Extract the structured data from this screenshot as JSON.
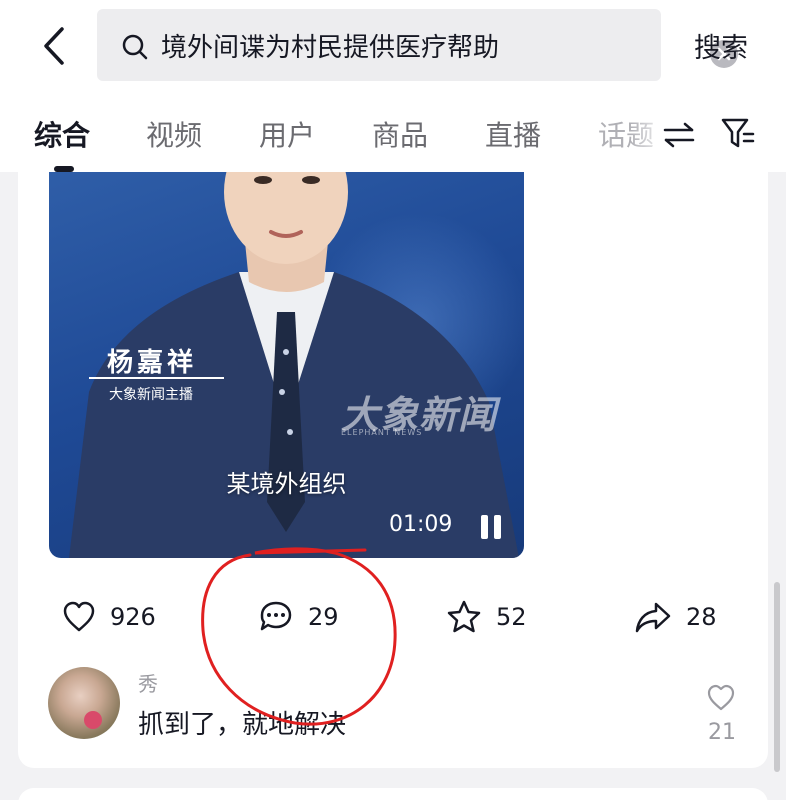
{
  "header": {
    "search_query": "境外间谍为村民提供医疗帮助",
    "search_button": "搜索"
  },
  "tabs": [
    {
      "label": "综合",
      "active": true
    },
    {
      "label": "视频",
      "active": false
    },
    {
      "label": "用户",
      "active": false
    },
    {
      "label": "商品",
      "active": false
    },
    {
      "label": "直播",
      "active": false
    },
    {
      "label": "话题",
      "active": false
    }
  ],
  "video": {
    "anchor_name": "杨嘉祥",
    "anchor_title": "大象新闻主播",
    "watermark": "大象新闻",
    "watermark_sub": "ELEPHANT NEWS",
    "subtitle": "某境外组织",
    "time": "01:09"
  },
  "actions": {
    "likes": "926",
    "comments": "29",
    "favorites": "52",
    "shares": "28"
  },
  "top_comment": {
    "user": "秀",
    "text": "抓到了，就地解决",
    "likes": "21"
  },
  "colors": {
    "annotation": "#e02020",
    "video_bg": "#1f4a96"
  }
}
